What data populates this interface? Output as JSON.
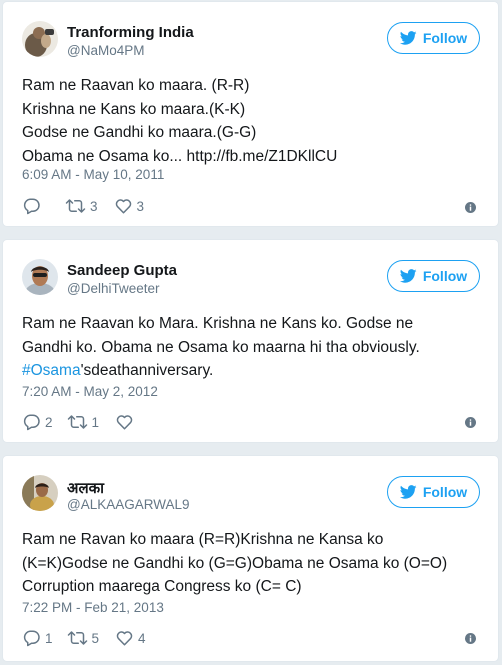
{
  "tweets": [
    {
      "author": {
        "name": "Tranforming India",
        "handle": "@NaMo4PM"
      },
      "follow_label": "Follow",
      "lines": [
        "Ram ne Raavan ko maara. (R-R)",
        "Krishna ne Kans ko maara.(K-K)",
        "Godse ne Gandhi ko maara.(G-G)"
      ],
      "last_line": {
        "text": "Obama ne Osama ko... ",
        "link": "http://fb.me/Z1DKllCU"
      },
      "timestamp": "6:09 AM - May 10, 2011",
      "reply_count": "",
      "retweet_count": "3",
      "like_count": "3"
    },
    {
      "author": {
        "name": "Sandeep Gupta",
        "handle": "@DelhiTweeter"
      },
      "follow_label": "Follow",
      "lines": [
        "Ram ne Raavan ko Mara. Krishna ne Kans ko. Godse ne",
        "Gandhi ko. Obama ne Osama ko maarna hi tha obviously."
      ],
      "last_line": {
        "hashtag": "#Osama",
        "text": "'sdeathanniversary."
      },
      "timestamp": "7:20 AM - May 2, 2012",
      "reply_count": "2",
      "retweet_count": "1",
      "like_count": ""
    },
    {
      "author": {
        "name": "अलका",
        "handle": "@ALKAAGARWAL9"
      },
      "follow_label": "Follow",
      "lines": [
        "Ram ne Ravan ko maara (R=R)Krishna ne Kansa ko",
        "(K=K)Godse ne Gandhi ko (G=G)Obama ne Osama ko (O=O)",
        "Corruption maarega Congress ko (C= C)"
      ],
      "timestamp": "7:22 PM - Feb 21, 2013",
      "reply_count": "1",
      "retweet_count": "5",
      "like_count": "4"
    }
  ],
  "colors": {
    "accent": "#1da1f2",
    "hashtag": "#1b95e0",
    "muted": "#657786",
    "text": "#14171a",
    "background": "#e6ecf0",
    "card_border": "#e1e8ed"
  },
  "icons": {
    "follow": "twitter-bird-icon",
    "reply": "reply-icon",
    "retweet": "retweet-icon",
    "like": "heart-icon",
    "info": "info-icon"
  }
}
